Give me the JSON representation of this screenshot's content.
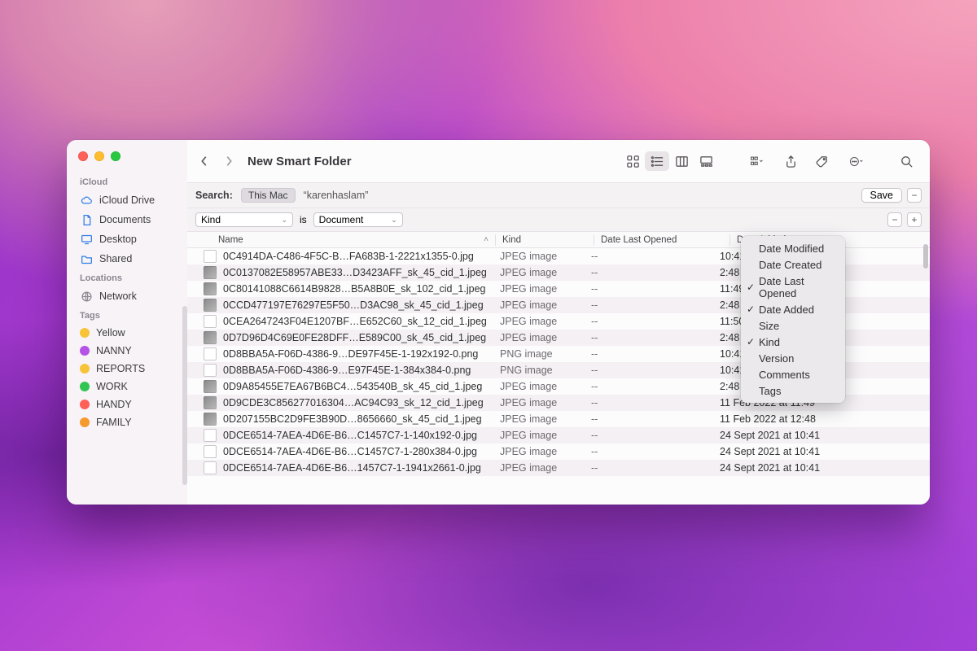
{
  "window_title": "New Smart Folder",
  "sidebar": {
    "sections": [
      {
        "label": "iCloud",
        "kind": "icloud",
        "items": [
          {
            "label": "iCloud Drive",
            "icon": "cloud"
          },
          {
            "label": "Documents",
            "icon": "doc"
          },
          {
            "label": "Desktop",
            "icon": "desktop"
          },
          {
            "label": "Shared",
            "icon": "folder"
          }
        ]
      },
      {
        "label": "Locations",
        "kind": "loc",
        "items": [
          {
            "label": "Network",
            "icon": "globe"
          }
        ]
      },
      {
        "label": "Tags",
        "kind": "tags",
        "items": [
          {
            "label": "Yellow",
            "color": "#f7c338"
          },
          {
            "label": "NANNY",
            "color": "#b453e6"
          },
          {
            "label": "REPORTS",
            "color": "#f7c338"
          },
          {
            "label": "WORK",
            "color": "#30c552"
          },
          {
            "label": "HANDY",
            "color": "#fe5f57"
          },
          {
            "label": "FAMILY",
            "color": "#f59a2e"
          }
        ]
      }
    ]
  },
  "toolbar": {
    "view_modes": [
      "icons",
      "list",
      "columns",
      "gallery"
    ],
    "active_view": "list"
  },
  "search": {
    "label": "Search:",
    "scope_active": "This Mac",
    "scope_alt": "“karenhaslam”",
    "save_label": "Save"
  },
  "rule": {
    "attr": "Kind",
    "op": "is",
    "value": "Document"
  },
  "columns": {
    "name": "Name",
    "kind": "Kind",
    "date_last_opened": "Date Last Opened",
    "date_added": "Date Added"
  },
  "context_menu": {
    "items": [
      {
        "label": "Date Modified",
        "checked": false
      },
      {
        "label": "Date Created",
        "checked": false
      },
      {
        "label": "Date Last Opened",
        "checked": true
      },
      {
        "label": "Date Added",
        "checked": true
      },
      {
        "label": "Size",
        "checked": false
      },
      {
        "label": "Kind",
        "checked": true
      },
      {
        "label": "Version",
        "checked": false
      },
      {
        "label": "Comments",
        "checked": false
      },
      {
        "label": "Tags",
        "checked": false
      }
    ]
  },
  "files": [
    {
      "name": "0C4914DA-C486-4F5C-B…FA683B-1-2221x1355-0.jpg",
      "kind": "JPEG image",
      "dlo": "--",
      "da": "10:41",
      "thumb": "doc"
    },
    {
      "name": "0C0137082E58957ABE33…D3423AFF_sk_45_cid_1.jpeg",
      "kind": "JPEG image",
      "dlo": "--",
      "da": "2:48",
      "thumb": "img"
    },
    {
      "name": "0C80141088C6614B9828…B5A8B0E_sk_102_cid_1.jpeg",
      "kind": "JPEG image",
      "dlo": "--",
      "da": "11:49",
      "thumb": "img"
    },
    {
      "name": "0CCD477197E76297E5F50…D3AC98_sk_45_cid_1.jpeg",
      "kind": "JPEG image",
      "dlo": "--",
      "da": "2:48",
      "thumb": "img"
    },
    {
      "name": "0CEA2647243F04E1207BF…E652C60_sk_12_cid_1.jpeg",
      "kind": "JPEG image",
      "dlo": "--",
      "da": "11:50",
      "thumb": "doc"
    },
    {
      "name": "0D7D96D4C69E0FE28DFF…E589C00_sk_45_cid_1.jpeg",
      "kind": "JPEG image",
      "dlo": "--",
      "da": "2:48",
      "thumb": "img"
    },
    {
      "name": "0D8BBA5A-F06D-4386-9…DE97F45E-1-192x192-0.png",
      "kind": "PNG image",
      "dlo": "--",
      "da": "10:41",
      "thumb": "doc"
    },
    {
      "name": "0D8BBA5A-F06D-4386-9…E97F45E-1-384x384-0.png",
      "kind": "PNG image",
      "dlo": "--",
      "da": "10:41",
      "thumb": "doc"
    },
    {
      "name": "0D9A85455E7EA67B6BC4…543540B_sk_45_cid_1.jpeg",
      "kind": "JPEG image",
      "dlo": "--",
      "da": "2:48",
      "thumb": "img"
    },
    {
      "name": "0D9CDE3C856277016304…AC94C93_sk_12_cid_1.jpeg",
      "kind": "JPEG image",
      "dlo": "--",
      "da": "11 Feb 2022 at 11:49",
      "thumb": "img"
    },
    {
      "name": "0D207155BC2D9FE3B90D…8656660_sk_45_cid_1.jpeg",
      "kind": "JPEG image",
      "dlo": "--",
      "da": "11 Feb 2022 at 12:48",
      "thumb": "img"
    },
    {
      "name": "0DCE6514-7AEA-4D6E-B6…C1457C7-1-140x192-0.jpg",
      "kind": "JPEG image",
      "dlo": "--",
      "da": "24 Sept 2021 at 10:41",
      "thumb": "doc"
    },
    {
      "name": "0DCE6514-7AEA-4D6E-B6…C1457C7-1-280x384-0.jpg",
      "kind": "JPEG image",
      "dlo": "--",
      "da": "24 Sept 2021 at 10:41",
      "thumb": "doc"
    },
    {
      "name": "0DCE6514-7AEA-4D6E-B6…1457C7-1-1941x2661-0.jpg",
      "kind": "JPEG image",
      "dlo": "--",
      "da": "24 Sept 2021 at 10:41",
      "thumb": "doc"
    }
  ]
}
